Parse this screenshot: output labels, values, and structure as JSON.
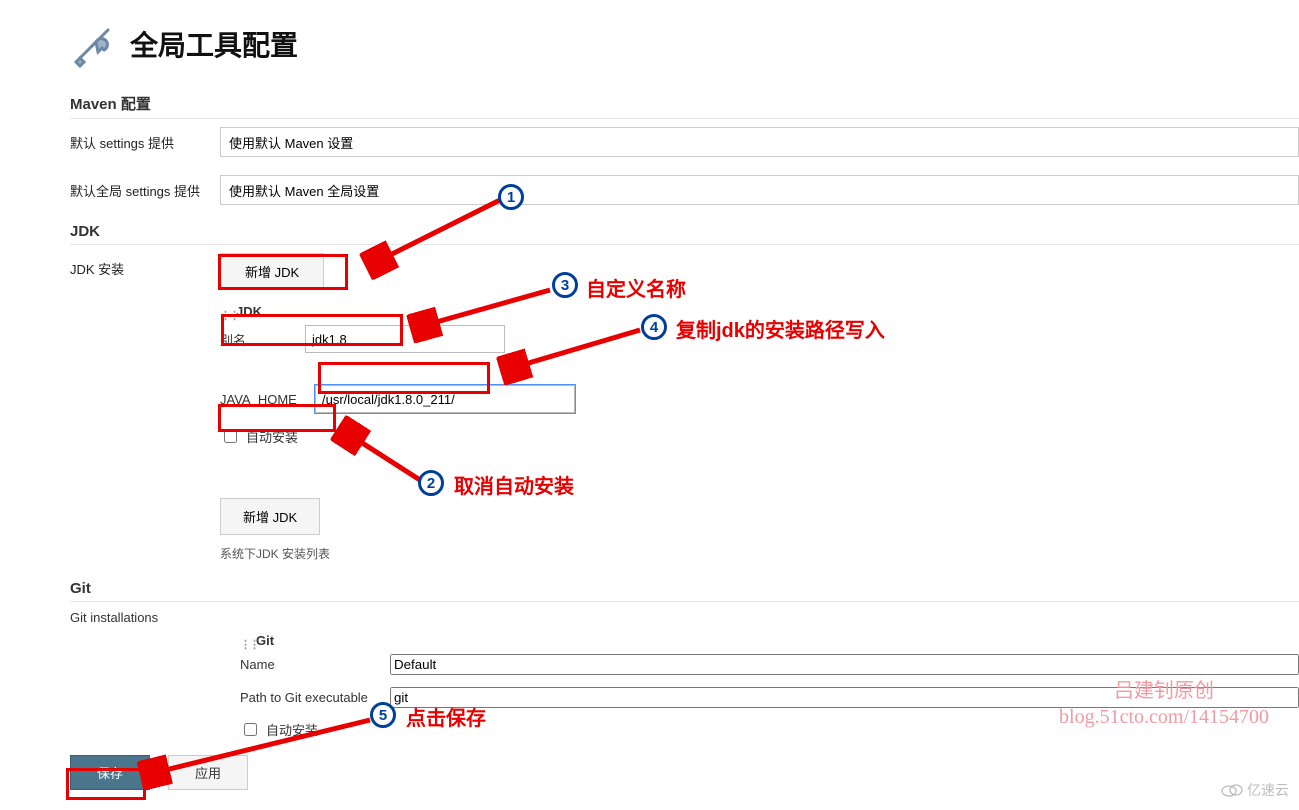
{
  "page_title": "全局工具配置",
  "sections": {
    "maven": {
      "title": "Maven 配置",
      "default_settings_label": "默认 settings 提供",
      "default_settings_value": "使用默认 Maven 设置",
      "default_global_label": "默认全局 settings 提供",
      "default_global_value": "使用默认 Maven 全局设置"
    },
    "jdk": {
      "title": "JDK",
      "install_label": "JDK 安装",
      "add_button": "新增 JDK",
      "group_name": "JDK",
      "alias_label": "别名",
      "alias_value": "jdk1.8",
      "home_label": "JAVA_HOME",
      "home_value": "/usr/local/jdk1.8.0_211/",
      "auto_install_label": "自动安装",
      "add_button2": "新增 JDK",
      "list_desc": "系统下JDK 安装列表"
    },
    "git": {
      "title": "Git",
      "installations_label": "Git installations",
      "group_name": "Git",
      "name_label": "Name",
      "name_value": "Default",
      "path_label": "Path to Git executable",
      "path_value": "git",
      "auto_install_label": "自动安装"
    }
  },
  "footer": {
    "save": "保存",
    "apply": "应用"
  },
  "annotations": {
    "1": "",
    "2": "取消自动安装",
    "3": "自定义名称",
    "4": "复制jdk的安装路径写入",
    "5": "点击保存"
  },
  "watermark": {
    "line1": "吕建钊原创",
    "line2": "blog.51cto.com/14154700",
    "brand": "亿速云"
  }
}
